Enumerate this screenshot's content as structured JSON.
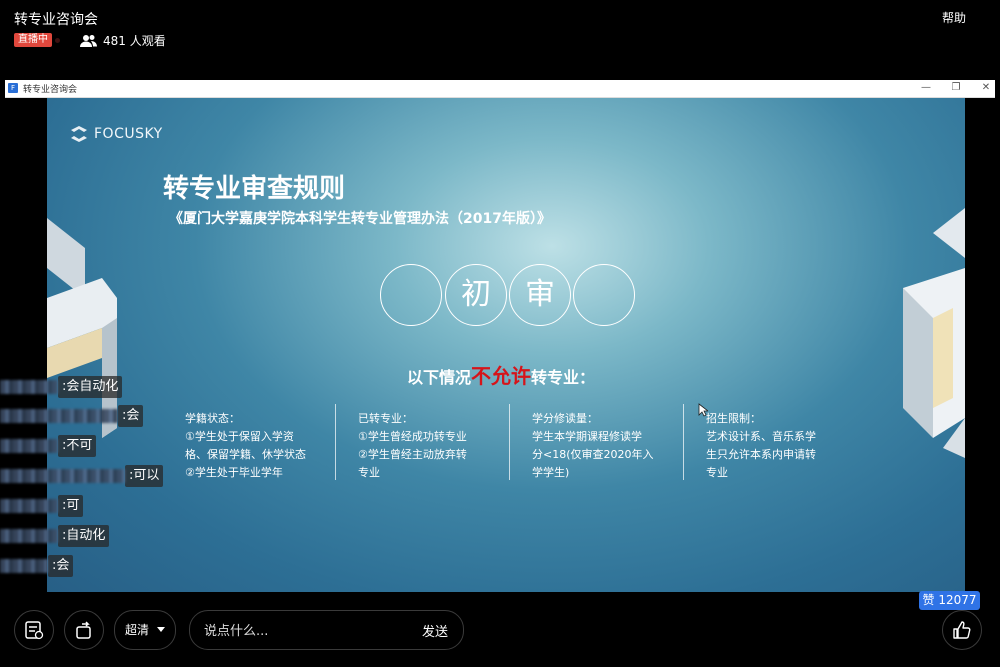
{
  "top": {
    "room_title": "转专业咨询会",
    "help": "帮助",
    "live_badge": "直播中",
    "viewers": "481 人观看"
  },
  "window": {
    "title": "转专业咨询会",
    "app_icon": "F",
    "controls": [
      "—",
      "❐",
      "✕"
    ]
  },
  "slide": {
    "logo": "FOCUSKY",
    "title": "转专业审查规则",
    "subtitle": "《厦门大学嘉庚学院本科学生转专业管理办法（2017年版）》",
    "circles": [
      "",
      "初",
      "审",
      ""
    ],
    "not_allowed_prefix": "以下情况",
    "not_allowed_red": "不允许",
    "not_allowed_suffix": "转专业：",
    "columns": [
      {
        "head": "学籍状态：",
        "lines": [
          "①学生处于保留入学资",
          "格、保留学籍、休学状态",
          "②学生处于毕业学年"
        ]
      },
      {
        "head": "已转专业：",
        "lines": [
          "①学生曾经成功转专业",
          "②学生曾经主动放弃转",
          "专业"
        ]
      },
      {
        "head": "学分修读量：",
        "lines": [
          "学生本学期课程修读学",
          "分<18(仅审查2020年入",
          "学学生)"
        ]
      },
      {
        "head": "招生限制：",
        "lines": [
          "艺术设计系、音乐系学",
          "生只允许本系内申请转",
          "专业"
        ]
      }
    ]
  },
  "danmu": [
    {
      "text": ":会自动化"
    },
    {
      "text": ":会"
    },
    {
      "text": ":不可"
    },
    {
      "text": ":可以"
    },
    {
      "text": ":可"
    },
    {
      "text": ":自动化"
    },
    {
      "text": ":会"
    }
  ],
  "like": {
    "badge": "赞 12077"
  },
  "bottom": {
    "quality": "超清",
    "chat_placeholder": "说点什么...",
    "send": "发送"
  },
  "colors": {
    "live_badge": "#e0483d",
    "like_badge": "#2f73e6",
    "highlight_red": "#d6141a"
  }
}
